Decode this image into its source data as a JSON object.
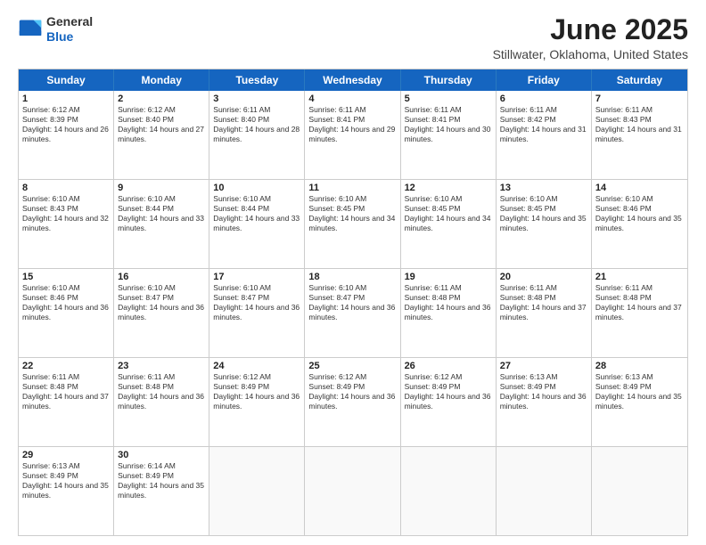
{
  "header": {
    "logo_general": "General",
    "logo_blue": "Blue",
    "month": "June 2025",
    "location": "Stillwater, Oklahoma, United States"
  },
  "weekdays": [
    "Sunday",
    "Monday",
    "Tuesday",
    "Wednesday",
    "Thursday",
    "Friday",
    "Saturday"
  ],
  "rows": [
    [
      {
        "day": "1",
        "text": "Sunrise: 6:12 AM\nSunset: 8:39 PM\nDaylight: 14 hours and 26 minutes."
      },
      {
        "day": "2",
        "text": "Sunrise: 6:12 AM\nSunset: 8:40 PM\nDaylight: 14 hours and 27 minutes."
      },
      {
        "day": "3",
        "text": "Sunrise: 6:11 AM\nSunset: 8:40 PM\nDaylight: 14 hours and 28 minutes."
      },
      {
        "day": "4",
        "text": "Sunrise: 6:11 AM\nSunset: 8:41 PM\nDaylight: 14 hours and 29 minutes."
      },
      {
        "day": "5",
        "text": "Sunrise: 6:11 AM\nSunset: 8:41 PM\nDaylight: 14 hours and 30 minutes."
      },
      {
        "day": "6",
        "text": "Sunrise: 6:11 AM\nSunset: 8:42 PM\nDaylight: 14 hours and 31 minutes."
      },
      {
        "day": "7",
        "text": "Sunrise: 6:11 AM\nSunset: 8:43 PM\nDaylight: 14 hours and 31 minutes."
      }
    ],
    [
      {
        "day": "8",
        "text": "Sunrise: 6:10 AM\nSunset: 8:43 PM\nDaylight: 14 hours and 32 minutes."
      },
      {
        "day": "9",
        "text": "Sunrise: 6:10 AM\nSunset: 8:44 PM\nDaylight: 14 hours and 33 minutes."
      },
      {
        "day": "10",
        "text": "Sunrise: 6:10 AM\nSunset: 8:44 PM\nDaylight: 14 hours and 33 minutes."
      },
      {
        "day": "11",
        "text": "Sunrise: 6:10 AM\nSunset: 8:45 PM\nDaylight: 14 hours and 34 minutes."
      },
      {
        "day": "12",
        "text": "Sunrise: 6:10 AM\nSunset: 8:45 PM\nDaylight: 14 hours and 34 minutes."
      },
      {
        "day": "13",
        "text": "Sunrise: 6:10 AM\nSunset: 8:45 PM\nDaylight: 14 hours and 35 minutes."
      },
      {
        "day": "14",
        "text": "Sunrise: 6:10 AM\nSunset: 8:46 PM\nDaylight: 14 hours and 35 minutes."
      }
    ],
    [
      {
        "day": "15",
        "text": "Sunrise: 6:10 AM\nSunset: 8:46 PM\nDaylight: 14 hours and 36 minutes."
      },
      {
        "day": "16",
        "text": "Sunrise: 6:10 AM\nSunset: 8:47 PM\nDaylight: 14 hours and 36 minutes."
      },
      {
        "day": "17",
        "text": "Sunrise: 6:10 AM\nSunset: 8:47 PM\nDaylight: 14 hours and 36 minutes."
      },
      {
        "day": "18",
        "text": "Sunrise: 6:10 AM\nSunset: 8:47 PM\nDaylight: 14 hours and 36 minutes."
      },
      {
        "day": "19",
        "text": "Sunrise: 6:11 AM\nSunset: 8:48 PM\nDaylight: 14 hours and 36 minutes."
      },
      {
        "day": "20",
        "text": "Sunrise: 6:11 AM\nSunset: 8:48 PM\nDaylight: 14 hours and 37 minutes."
      },
      {
        "day": "21",
        "text": "Sunrise: 6:11 AM\nSunset: 8:48 PM\nDaylight: 14 hours and 37 minutes."
      }
    ],
    [
      {
        "day": "22",
        "text": "Sunrise: 6:11 AM\nSunset: 8:48 PM\nDaylight: 14 hours and 37 minutes."
      },
      {
        "day": "23",
        "text": "Sunrise: 6:11 AM\nSunset: 8:48 PM\nDaylight: 14 hours and 36 minutes."
      },
      {
        "day": "24",
        "text": "Sunrise: 6:12 AM\nSunset: 8:49 PM\nDaylight: 14 hours and 36 minutes."
      },
      {
        "day": "25",
        "text": "Sunrise: 6:12 AM\nSunset: 8:49 PM\nDaylight: 14 hours and 36 minutes."
      },
      {
        "day": "26",
        "text": "Sunrise: 6:12 AM\nSunset: 8:49 PM\nDaylight: 14 hours and 36 minutes."
      },
      {
        "day": "27",
        "text": "Sunrise: 6:13 AM\nSunset: 8:49 PM\nDaylight: 14 hours and 36 minutes."
      },
      {
        "day": "28",
        "text": "Sunrise: 6:13 AM\nSunset: 8:49 PM\nDaylight: 14 hours and 35 minutes."
      }
    ],
    [
      {
        "day": "29",
        "text": "Sunrise: 6:13 AM\nSunset: 8:49 PM\nDaylight: 14 hours and 35 minutes."
      },
      {
        "day": "30",
        "text": "Sunrise: 6:14 AM\nSunset: 8:49 PM\nDaylight: 14 hours and 35 minutes."
      },
      {
        "day": "",
        "text": ""
      },
      {
        "day": "",
        "text": ""
      },
      {
        "day": "",
        "text": ""
      },
      {
        "day": "",
        "text": ""
      },
      {
        "day": "",
        "text": ""
      }
    ]
  ]
}
